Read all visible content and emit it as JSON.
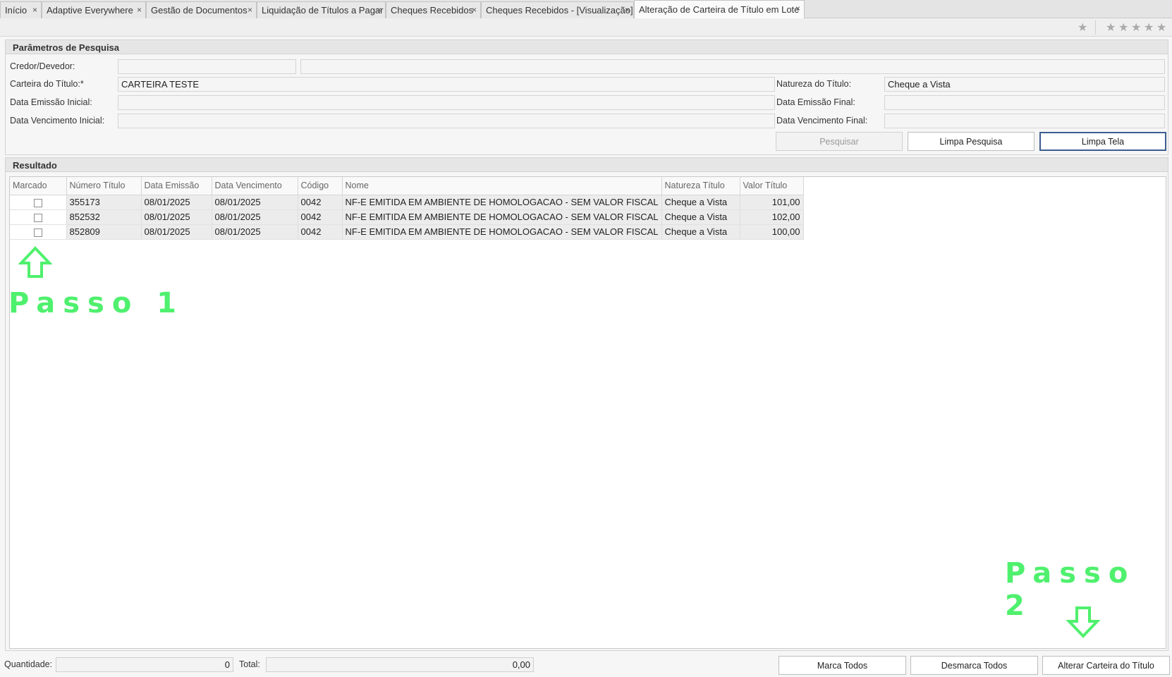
{
  "tabs": [
    {
      "label": "Início"
    },
    {
      "label": "Adaptive Everywhere"
    },
    {
      "label": "Gestão de Documentos"
    },
    {
      "label": "Liquidação de Títulos a Pagar"
    },
    {
      "label": "Cheques Recebidos"
    },
    {
      "label": "Cheques Recebidos - [Visualização]"
    },
    {
      "label": "Alteração de Carteira de Título em Lote"
    }
  ],
  "tab_close_glyph": "×",
  "toolbar": {
    "star_glyph": "★",
    "rating_glyph": "★"
  },
  "search": {
    "title": "Parâmetros de Pesquisa",
    "credor_label": "Credor/Devedor:",
    "credor_code": "",
    "credor_name": "",
    "carteira_label": "Carteira do Título:*",
    "carteira_value": "CARTEIRA TESTE",
    "natureza_label": "Natureza do Título:",
    "natureza_value": "Cheque a Vista",
    "emissao_ini_label": "Data Emissão Inicial:",
    "emissao_ini_value": "",
    "emissao_fim_label": "Data Emissão Final:",
    "emissao_fim_value": "",
    "venc_ini_label": "Data Vencimento Inicial:",
    "venc_ini_value": "",
    "venc_fim_label": "Data Vencimento Final:",
    "venc_fim_value": "",
    "btn_pesquisar": "Pesquisar",
    "btn_limpa_pesquisa": "Limpa Pesquisa",
    "btn_limpa_tela": "Limpa Tela"
  },
  "result": {
    "title": "Resultado",
    "columns": [
      "Marcado",
      "Número Título",
      "Data Emissão",
      "Data Vencimento",
      "Código",
      "Nome",
      "Natureza Título",
      "Valor Título"
    ],
    "rows": [
      {
        "numero": "355173",
        "emissao": "08/01/2025",
        "vencimento": "08/01/2025",
        "codigo": "0042",
        "nome": "NF-E EMITIDA EM AMBIENTE DE HOMOLOGACAO - SEM VALOR FISCAL",
        "natureza": "Cheque a Vista",
        "valor": "101,00",
        "marcado": false
      },
      {
        "numero": "852532",
        "emissao": "08/01/2025",
        "vencimento": "08/01/2025",
        "codigo": "0042",
        "nome": "NF-E EMITIDA EM AMBIENTE DE HOMOLOGACAO - SEM VALOR FISCAL",
        "natureza": "Cheque a Vista",
        "valor": "102,00",
        "marcado": false
      },
      {
        "numero": "852809",
        "emissao": "08/01/2025",
        "vencimento": "08/01/2025",
        "codigo": "0042",
        "nome": "NF-E EMITIDA EM AMBIENTE DE HOMOLOGACAO - SEM VALOR FISCAL",
        "natureza": "Cheque a Vista",
        "valor": "100,00",
        "marcado": false
      }
    ]
  },
  "footer": {
    "quantidade_label": "Quantidade:",
    "quantidade_value": "0",
    "total_label": "Total:",
    "total_value": "0,00",
    "btn_marca_todos": "Marca Todos",
    "btn_desmarca_todos": "Desmarca Todos",
    "btn_alterar": "Alterar Carteira do Título"
  },
  "annotations": {
    "passo1": "Passo 1",
    "passo2": "Passo 2",
    "color": "#4ff06d"
  }
}
